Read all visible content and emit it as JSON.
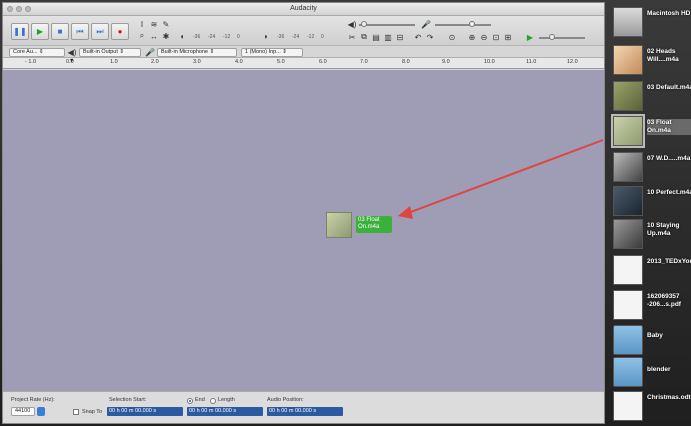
{
  "window": {
    "title": "Audacity"
  },
  "devices": {
    "host": "Core Au...",
    "output": "Built-in Output",
    "input": "Built-in Microphone",
    "channels": "1 (Mono) Inp..."
  },
  "ruler": {
    "ticks": [
      "- 1.0",
      "0.0",
      "1.0",
      "2.0",
      "3.0",
      "4.0",
      "5.0",
      "6.0",
      "7.0",
      "8.0",
      "9.0",
      "10.0",
      "11.0",
      "12.0"
    ]
  },
  "meters": {
    "rec": [
      "-36",
      "-24",
      "-12",
      "0"
    ],
    "play": [
      "-36",
      "-24",
      "-12",
      "0"
    ]
  },
  "status": {
    "project_rate_label": "Project Rate (Hz):",
    "project_rate": "44100",
    "snap_to": "Snap To",
    "selection_start_label": "Selection Start:",
    "end_label": "End",
    "length_label": "Length",
    "audio_position_label": "Audio Position:",
    "start_value": "00 h 00 m 00.000 s",
    "end_value": "00 h 00 m 00.000 s",
    "position_value": "00 h 00 m 00.000 s"
  },
  "drag": {
    "label": "03 Float On.m4a"
  },
  "desktop": {
    "items": [
      {
        "name": "Macintosh HD",
        "type": "drive"
      },
      {
        "name": "02 Heads Will....m4a",
        "type": "audio"
      },
      {
        "name": "03 Default.m4a",
        "type": "audio"
      },
      {
        "name": "03 Float On.m4a",
        "type": "audio",
        "selected": true
      },
      {
        "name": "07 W.D.....m4a",
        "type": "audio"
      },
      {
        "name": "10 Perfect.m4a",
        "type": "audio"
      },
      {
        "name": "10 Staying Up.m4a",
        "type": "audio"
      },
      {
        "name": "2013_TEDxYouth...docx",
        "type": "document"
      },
      {
        "name": "162069357 -206...s.pdf",
        "type": "document"
      },
      {
        "name": "Baby",
        "type": "folder"
      },
      {
        "name": "blender",
        "type": "folder"
      },
      {
        "name": "Christmas.odt",
        "type": "document"
      }
    ]
  },
  "colors": {
    "track_bg": "#9f9cb5",
    "drag_label": "#3bb03b",
    "arrow": "#e0443e"
  }
}
